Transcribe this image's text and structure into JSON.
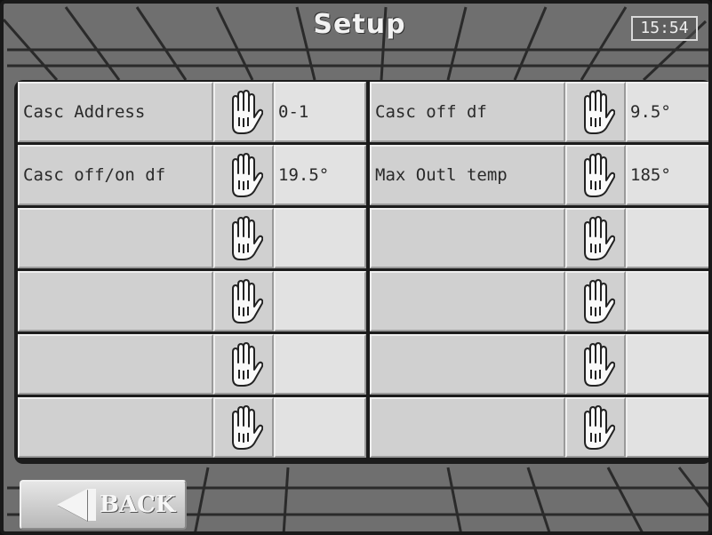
{
  "header": {
    "title": "Setup",
    "clock": "15:54"
  },
  "rows": [
    {
      "left": {
        "label": "Casc Address",
        "value": "0-1"
      },
      "right": {
        "label": "Casc off df",
        "value": "9.5°"
      }
    },
    {
      "left": {
        "label": "Casc off/on df",
        "value": "19.5°"
      },
      "right": {
        "label": "Max Outl temp",
        "value": "185°"
      }
    },
    {
      "left": {
        "label": "",
        "value": ""
      },
      "right": {
        "label": "",
        "value": ""
      }
    },
    {
      "left": {
        "label": "",
        "value": ""
      },
      "right": {
        "label": "",
        "value": ""
      }
    },
    {
      "left": {
        "label": "",
        "value": ""
      },
      "right": {
        "label": "",
        "value": ""
      }
    },
    {
      "left": {
        "label": "",
        "value": ""
      },
      "right": {
        "label": "",
        "value": ""
      }
    }
  ],
  "back_button": {
    "label": "BACK",
    "icon": "left-arrow-icon"
  },
  "edit_icon": "hand-icon",
  "colors": {
    "cell": "#d0d0d0",
    "value_cell": "#e2e2e2",
    "background": "#6f6f6f",
    "text": "#2a2a2a"
  }
}
